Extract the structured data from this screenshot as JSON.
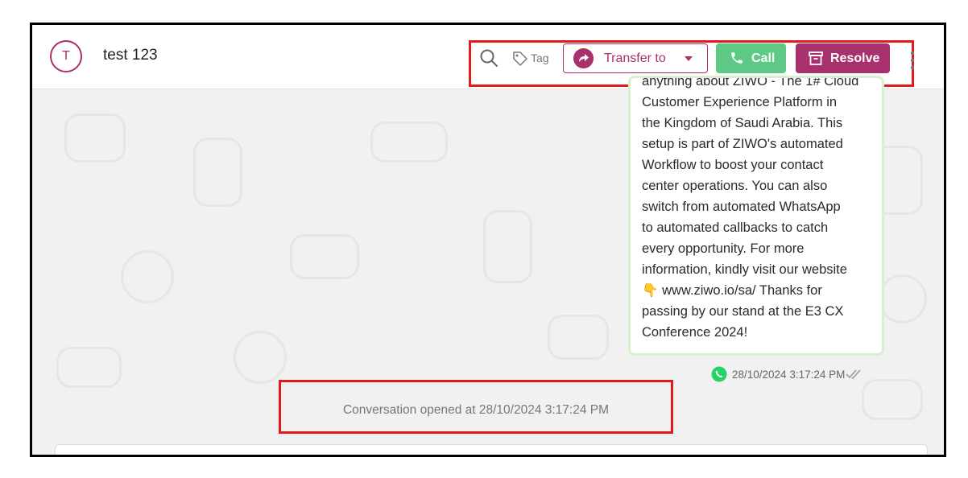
{
  "header": {
    "avatar_initial": "T",
    "contact_name": "test 123",
    "tag_label": "Tag",
    "transfer_label": "Transfer to",
    "call_label": "Call",
    "resolve_label": "Resolve"
  },
  "message": {
    "text": "anything about ZIWO - The 1# Cloud\nCustomer Experience Platform in\nthe Kingdom of Saudi Arabia. This\nsetup is part of ZIWO's automated\nWorkflow to boost your contact\ncenter operations. You can also\nswitch from automated WhatsApp\nto automated callbacks to catch\nevery opportunity. For more\ninformation, kindly visit our website\n👇 www.ziwo.io/sa/ Thanks for\npassing by our stand at the E3 CX\nConference 2024!",
    "timestamp": "28/10/2024 3:17:24 PM"
  },
  "conversation_status": "Conversation opened at 28/10/2024 3:17:24 PM",
  "colors": {
    "brand": "#a8316d",
    "call_green": "#5ec985",
    "highlight_red": "#e3191c",
    "bubble_border": "#d5f2cc"
  },
  "icons": [
    "search-icon",
    "tag-icon",
    "transfer-icon",
    "phone-icon",
    "archive-icon",
    "more-vertical-icon",
    "whatsapp-icon",
    "double-check-icon"
  ]
}
